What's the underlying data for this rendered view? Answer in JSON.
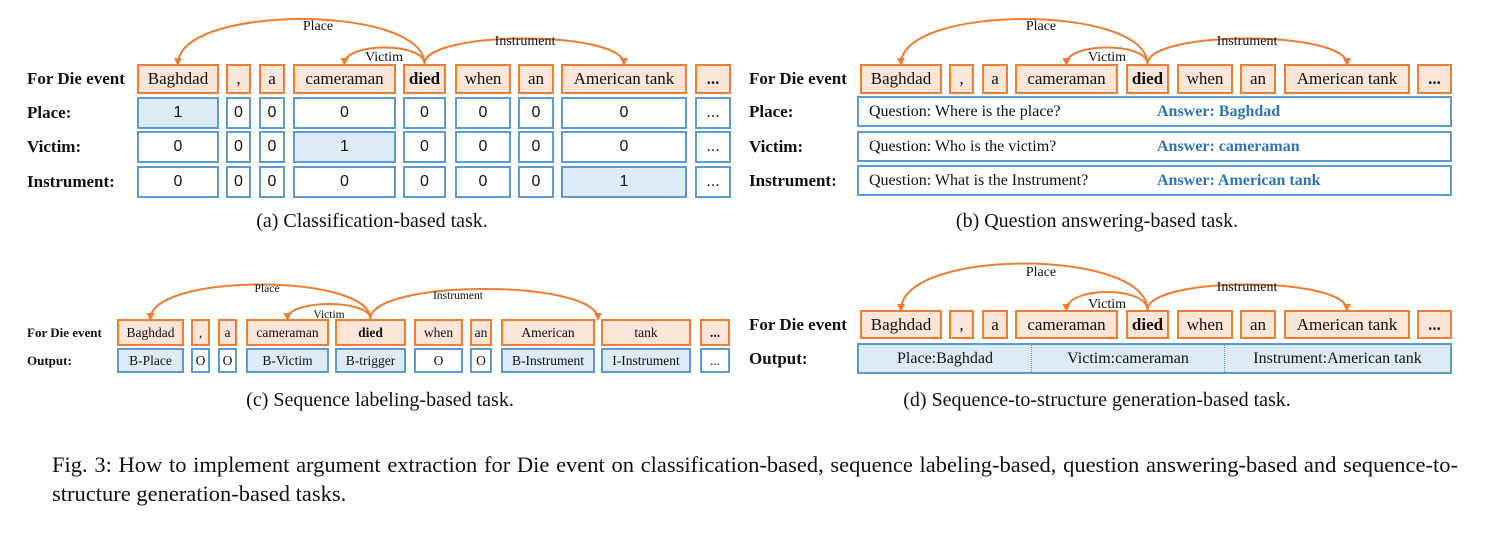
{
  "colors": {
    "token_border": "#ED7D31",
    "token_fill": "#FBE5D6",
    "cell_border": "#5B9BD5",
    "highlight_fill": "#DEEBF7",
    "answer_text": "#2E75B6",
    "arc": "#ED7D31"
  },
  "tokens": [
    "Baghdad",
    ",",
    "a",
    "cameraman",
    "died",
    "when",
    "an",
    "American tank",
    "..."
  ],
  "tokens_split": [
    "Baghdad",
    ",",
    "a",
    "cameraman",
    "died",
    "when",
    "an",
    "American",
    "tank",
    "..."
  ],
  "event_label": "For Die event",
  "arc_labels": {
    "place": "Place",
    "victim": "Victim",
    "instrument": "Instrument"
  },
  "panel_a": {
    "caption": "(a)  Classification-based task.",
    "rows": [
      {
        "label": "Place:",
        "values": [
          "1",
          "0",
          "0",
          "0",
          "0",
          "0",
          "0",
          "0",
          "..."
        ]
      },
      {
        "label": "Victim:",
        "values": [
          "0",
          "0",
          "0",
          "1",
          "0",
          "0",
          "0",
          "0",
          "..."
        ]
      },
      {
        "label": "Instrument:",
        "values": [
          "0",
          "0",
          "0",
          "0",
          "0",
          "0",
          "0",
          "1",
          "..."
        ]
      }
    ]
  },
  "panel_b": {
    "caption": "(b)  Question answering-based task.",
    "rows": [
      {
        "label": "Place:",
        "question": "Question: Where is the place?",
        "answer": "Answer: Baghdad"
      },
      {
        "label": "Victim:",
        "question": "Question: Who is the victim?",
        "answer": "Answer: cameraman"
      },
      {
        "label": "Instrument:",
        "question": "Question: What is the Instrument?",
        "answer": "Answer: American tank"
      }
    ]
  },
  "panel_c": {
    "caption": "(c)  Sequence labeling-based task.",
    "output_label": "Output:",
    "labels": [
      "B-Place",
      "O",
      "O",
      "B-Victim",
      "B-trigger",
      "O",
      "O",
      "B-Instrument",
      "I-Instrument",
      "..."
    ]
  },
  "panel_d": {
    "caption": "(d)  Sequence-to-structure generation-based task.",
    "output_label": "Output:",
    "segments": [
      "Place:Baghdad",
      "Victim:cameraman",
      "Instrument:American tank"
    ]
  },
  "figure_caption": "Fig. 3: How to implement argument extraction for Die event on classification-based, sequence labeling-based, question answering-based and sequence-to-structure generation-based tasks."
}
